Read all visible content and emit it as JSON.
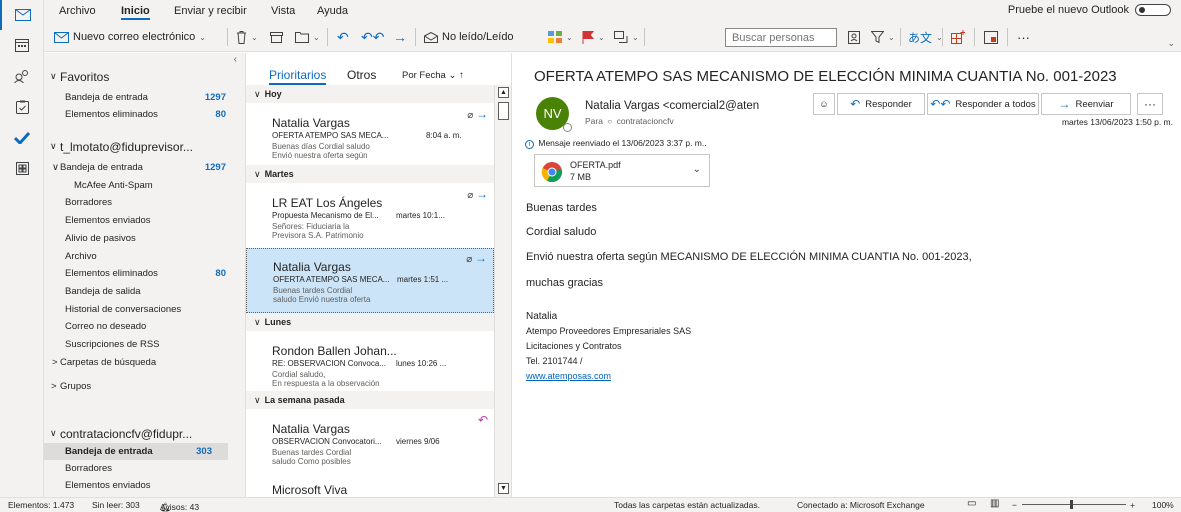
{
  "ribbon": {
    "menu": [
      "Archivo",
      "Inicio",
      "Enviar y recibir",
      "Vista",
      "Ayuda"
    ],
    "try_new_outlook": "Pruebe el nuevo Outlook",
    "new_email": "Nuevo correo electrónico",
    "read_unread": "No leído/Leído",
    "search_people_placeholder": "Buscar personas",
    "more": "···"
  },
  "folders": {
    "favorites_header": "Favoritos",
    "favorites": [
      {
        "label": "Bandeja de entrada",
        "count": "1297"
      },
      {
        "label": "Elementos eliminados",
        "count": "80"
      }
    ],
    "account1": "t_lmotato@fiduprevisor...",
    "account1_items": [
      {
        "label": "Bandeja de entrada",
        "count": "1297",
        "prefix": "∨"
      },
      {
        "label": "McAfee Anti-Spam",
        "count": ""
      },
      {
        "label": "Borradores",
        "count": ""
      },
      {
        "label": "Elementos enviados",
        "count": ""
      },
      {
        "label": "Alivio de pasivos",
        "count": ""
      },
      {
        "label": "Archivo",
        "count": ""
      },
      {
        "label": "Elementos eliminados",
        "count": "80"
      },
      {
        "label": "Bandeja de salida",
        "count": ""
      },
      {
        "label": "Historial de conversaciones",
        "count": ""
      },
      {
        "label": "Correo no deseado",
        "count": ""
      },
      {
        "label": "Suscripciones de RSS",
        "count": ""
      },
      {
        "label": "Carpetas de búsqueda",
        "count": "",
        "prefix": ">"
      }
    ],
    "groups": "Grupos",
    "account2": "contratacioncfv@fidupr...",
    "account2_items": [
      {
        "label": "Bandeja de entrada",
        "count": "303"
      },
      {
        "label": "Borradores",
        "count": ""
      },
      {
        "label": "Elementos enviados",
        "count": ""
      }
    ]
  },
  "list": {
    "tab_focused": "Prioritarios",
    "tab_other": "Otros",
    "sort": "Por Fecha",
    "groups": {
      "today": "Hoy",
      "tuesday": "Martes",
      "monday": "Lunes",
      "last_week": "La semana pasada"
    },
    "messages": [
      {
        "from": "Natalia Vargas",
        "subject": "OFERTA ATEMPO SAS MECA...",
        "time": "8:04 a. m.",
        "preview1": "Buenas días  Cordial saludo",
        "preview2": "Envió nuestra oferta según"
      },
      {
        "from": "LR EAT Los Ángeles",
        "subject": "Propuesta Mecanismo de El...",
        "time": "martes 10:1...",
        "preview1": "Señores: Fiduciaria la",
        "preview2": "Previsora S.A. Patrimonio"
      },
      {
        "from": "Natalia Vargas",
        "subject": "OFERTA ATEMPO SAS MECA...",
        "time": "martes 1:51 ...",
        "preview1": "Buenas tardes  Cordial",
        "preview2": "saludo  Envió nuestra oferta"
      },
      {
        "from": "Rondon Ballen Johan...",
        "subject": "RE: OBSERVACION Convoca...",
        "time": "lunes 10:26 ...",
        "preview1": "Cordial saludo,",
        "preview2": "En respuesta a la observación"
      },
      {
        "from": "Natalia Vargas",
        "subject": "OBSERVACION Convocatori...",
        "time": "viernes 9/06",
        "preview1": "Buenas tardes  Cordial",
        "preview2": "saludo  Como posibles"
      },
      {
        "from": "Microsoft Viva",
        "subject": "",
        "time": "",
        "preview1": "",
        "preview2": ""
      }
    ]
  },
  "reader": {
    "subject": "OFERTA ATEMPO SAS MECANISMO DE ELECCIÓN MINIMA CUANTIA No. 001-2023",
    "avatar_initials": "NV",
    "sender": "Natalia Vargas <comercial2@aten",
    "to_label": "Para",
    "to": "contratacioncfv",
    "reply": "Responder",
    "reply_all": "Responder a todos",
    "forward": "Reenviar",
    "date": "martes 13/06/2023 1:50 p. m.",
    "forward_info": "Mensaje reenviado el 13/06/2023 3:37 p. m..",
    "attachment_name": "OFERTA.pdf",
    "attachment_size": "7 MB",
    "body": [
      "Buenas tardes",
      "Cordial saludo",
      "Envió nuestra oferta según MECANISMO DE ELECCIÓN MINIMA CUANTIA No. 001-2023,",
      "muchas gracias"
    ],
    "signature": {
      "name": "Natalia",
      "company": "Atempo Proveedores Empresariales SAS",
      "dept": "Licitaciones y Contratos",
      "phone": "Tel. 2101744 /",
      "website": "www.atemposas.com"
    }
  },
  "status": {
    "items": "Elementos: 1.473",
    "unread": "Sin leer: 303",
    "alerts": "Avisos: 43",
    "sync": "Todas las carpetas están actualizadas.",
    "connection": "Conectado a: Microsoft Exchange",
    "zoom": "100%"
  },
  "colors": {
    "accent": "#0f6cbd",
    "avatar": "#498205",
    "selected": "#cce4f7"
  }
}
